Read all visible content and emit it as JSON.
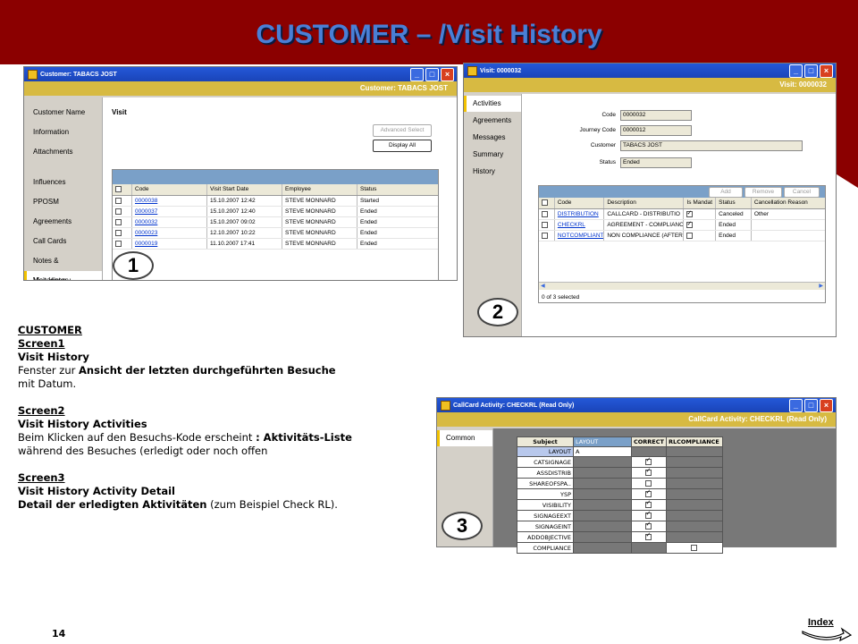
{
  "slide_title": "CUSTOMER – /Visit History",
  "screen1": {
    "title": "Customer: TABACS JOST",
    "header": "Customer: TABACS JOST",
    "nav": [
      "Customer Name",
      "Information",
      "Attachments",
      "Influences",
      "PPOSM",
      "Agreements",
      "Call Cards",
      "Notes & Messages",
      "Visit History"
    ],
    "section": "Visit",
    "btn_advanced": "Advanced Select",
    "btn_display": "Display All",
    "columns": [
      "Code",
      "Visit Start Date",
      "Employee",
      "Status"
    ],
    "rows": [
      [
        "0000038",
        "15.10.2007 12:42",
        "STEVE MONNARD",
        "Started"
      ],
      [
        "0000037",
        "15.10.2007 12:40",
        "STEVE MONNARD",
        "Ended"
      ],
      [
        "0000032",
        "15.10.2007 09:02",
        "STEVE MONNARD",
        "Ended"
      ],
      [
        "0000023",
        "12.10.2007 10:22",
        "STEVE MONNARD",
        "Ended"
      ],
      [
        "0000019",
        "11.10.2007 17:41",
        "STEVE MONNARD",
        "Ended"
      ]
    ],
    "badge": "1"
  },
  "screen2": {
    "title": "Visit: 0000032",
    "header": "Visit: 0000032",
    "nav": [
      "Activities",
      "Agreements",
      "Messages",
      "Summary",
      "History"
    ],
    "fields": [
      {
        "label": "Code",
        "value": "0000032"
      },
      {
        "label": "Journey Code",
        "value": "0000012"
      },
      {
        "label": "Customer",
        "value": "TABACS JOST"
      },
      {
        "label": "Status",
        "value": "Ended"
      }
    ],
    "btn_add": "Add",
    "btn_remove": "Remove",
    "btn_cancel": "Cancel",
    "columns": [
      "Code",
      "Description",
      "Is Mandat",
      "Status",
      "Cancellation Reason"
    ],
    "rows": [
      {
        "code": "DISTRIBUTION",
        "desc": "CALLCARD - DISTRIBUTIO",
        "mandatory": true,
        "status": "Canceled",
        "reason": "Other"
      },
      {
        "code": "CHECKRL",
        "desc": "AGREEMENT - COMPLIANC",
        "mandatory": true,
        "status": "Ended",
        "reason": ""
      },
      {
        "code": "NOTCOMPLIANT",
        "desc": "NON COMPLIANCE (AFTER",
        "mandatory": false,
        "status": "Ended",
        "reason": ""
      }
    ],
    "footer": "0 of 3 selected",
    "badge": "2"
  },
  "screen3": {
    "title": "CallCard Activity: CHECKRL (Read Only)",
    "header": "CallCard Activity: CHECKRL (Read Only)",
    "nav": [
      "Common"
    ],
    "head": [
      "Subject",
      "LAYOUT",
      "CORRECT",
      "RLCOMPLIANCE"
    ],
    "rows": [
      {
        "subject": "LAYOUT",
        "layout": "A",
        "correct": null
      },
      {
        "subject": "CATSIGNAGE",
        "layout": "",
        "correct": true
      },
      {
        "subject": "ASSDISTRIB",
        "layout": "",
        "correct": true
      },
      {
        "subject": "SHAREOFSPA..",
        "layout": "",
        "correct": false
      },
      {
        "subject": "YSP",
        "layout": "",
        "correct": true
      },
      {
        "subject": "VISIBILITY",
        "layout": "",
        "correct": true
      },
      {
        "subject": "SIGNAGEEXT",
        "layout": "",
        "correct": true
      },
      {
        "subject": "SIGNAGEINT",
        "layout": "",
        "correct": true
      },
      {
        "subject": "ADDOBJECTIVE",
        "layout": "",
        "correct": true
      },
      {
        "subject": "COMPLIANCE",
        "layout": "",
        "correct": null,
        "rl": false
      }
    ],
    "badge": "3"
  },
  "notes": {
    "customer": "CUSTOMER",
    "s1": "Screen1",
    "s1_title": "Visit History",
    "s1_line1_a": "Fenster zur ",
    "s1_line1_b": "Ansicht der letzten durchgeführten Besuche",
    "s1_line2": "mit Datum.",
    "s2": "Screen2",
    "s2_title": "Visit History Activities",
    "s2_line1_a": "Beim Klicken auf den Besuchs-Kode erscheint ",
    "s2_line1_b": ": Aktivitäts-Liste",
    "s2_line2": "während des Besuches (erledigt oder noch offen",
    "s3": "Screen3",
    "s3_title": "Visit History Activity Detail",
    "s3_line1_a": "Detail der erledigten Aktivitäten",
    "s3_line1_b": " (zum Beispiel Check RL)."
  },
  "page_number": "14",
  "index_label": "Index"
}
